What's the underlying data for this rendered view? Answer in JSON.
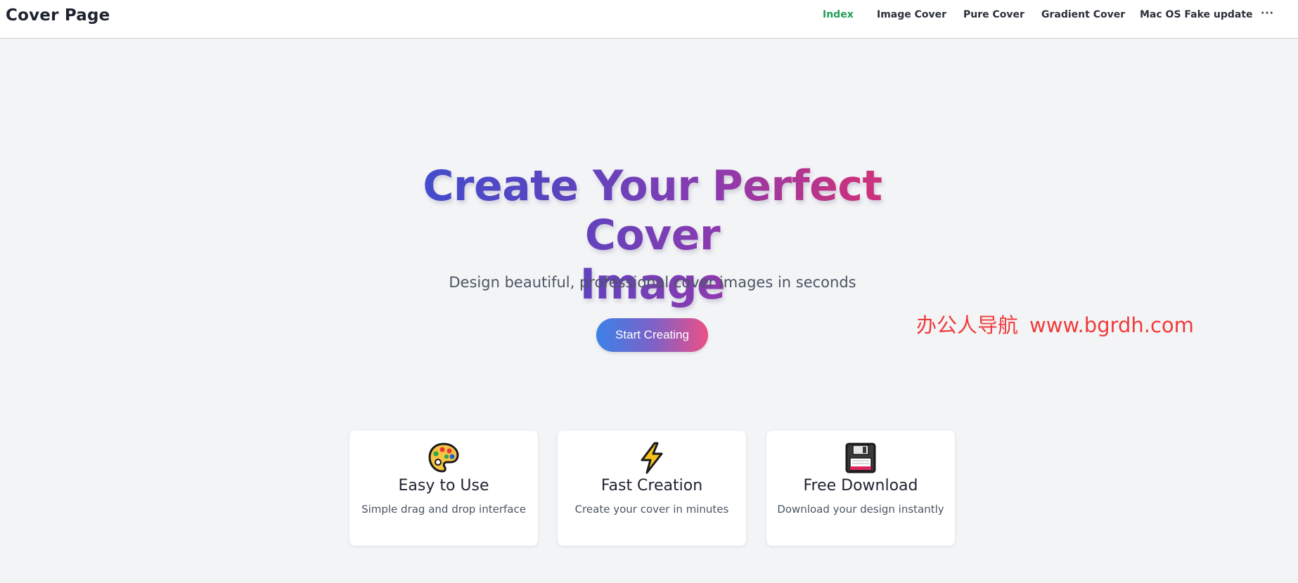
{
  "header": {
    "brand": "Cover Page",
    "nav": [
      {
        "label": "Index",
        "active": true
      },
      {
        "label": "Image Cover"
      },
      {
        "label": "Pure Cover"
      },
      {
        "label": "Gradient Cover"
      },
      {
        "label": "Mac OS Fake update"
      },
      {
        "label": "···"
      }
    ],
    "active_color": "#1f9d55"
  },
  "hero": {
    "title_line1": "Create Your Perfect Cover",
    "title_line2": "Image",
    "subtitle": "Design beautiful, professional cover images in seconds",
    "cta_label": "Start Creating"
  },
  "watermark": {
    "name": "办公人导航",
    "url": "www.bgrdh.com",
    "color": "#ef3b3b"
  },
  "features": [
    {
      "icon": "palette-icon",
      "title": "Easy to Use",
      "description": "Simple drag and drop interface"
    },
    {
      "icon": "lightning-icon",
      "title": "Fast Creation",
      "description": "Create your cover in minutes"
    },
    {
      "icon": "floppy-disk-icon",
      "title": "Free Download",
      "description": "Download your design instantly"
    }
  ]
}
